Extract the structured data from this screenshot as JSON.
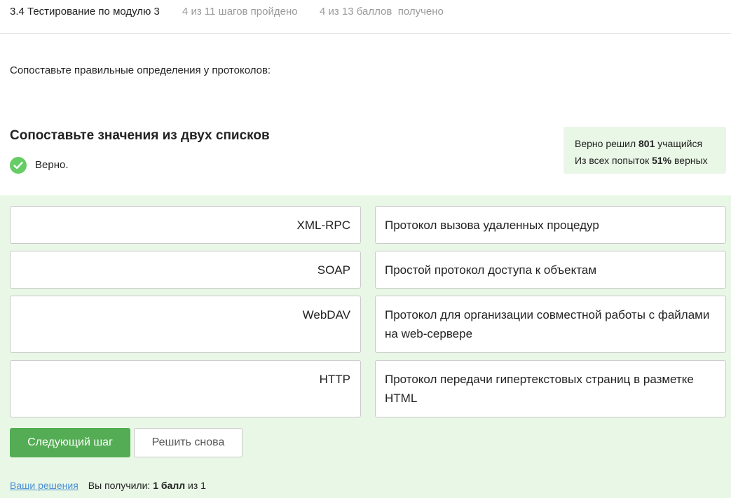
{
  "header": {
    "lesson": "3.4 Тестирование по модулю 3",
    "steps": "4 из 11 шагов пройдено",
    "score": "4 из 13 баллов  получено"
  },
  "question": "Сопоставьте правильные определения у протоколов:",
  "task": {
    "title": "Сопоставьте значения из двух списков",
    "verdict": "Верно."
  },
  "stats": {
    "line1_prefix": "Верно решил ",
    "line1_count": "801",
    "line1_suffix": " учащийся",
    "line2_prefix": "Из всех попыток ",
    "line2_percent": "51%",
    "line2_suffix": " верных"
  },
  "pairs": [
    {
      "left": "XML-RPC",
      "right": "Протокол вызова удаленных процедур"
    },
    {
      "left": "SOAP",
      "right": "Простой протокол доступа к объектам"
    },
    {
      "left": "WebDAV",
      "right": "Протокол для организации совместной работы с файлами на web-сервере"
    },
    {
      "left": "HTTP",
      "right": "Протокол передачи гипертекстовых страниц в разметке HTML"
    }
  ],
  "buttons": {
    "next": "Следующий шаг",
    "retry": "Решить снова"
  },
  "footer": {
    "solutions_link": "Ваши решения",
    "received_prefix": "Вы получили: ",
    "received_value": "1 балл",
    "received_suffix": " из 1"
  },
  "colors": {
    "accent": "#54ad54",
    "success_bg": "#e9f7e6",
    "check": "#66cc66",
    "link": "#4a8fd6"
  },
  "icons": {
    "verdict": "check-circle-icon"
  }
}
